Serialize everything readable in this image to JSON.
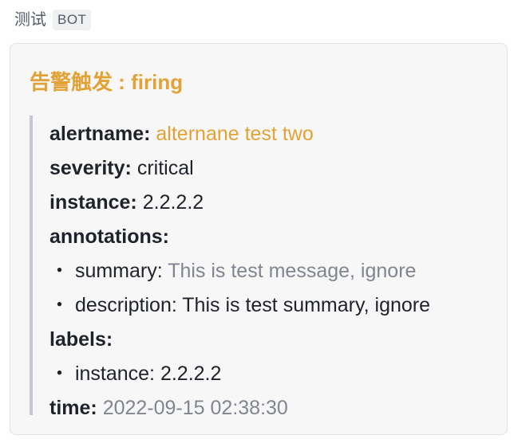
{
  "header": {
    "sender": "测试",
    "badge": "BOT"
  },
  "card": {
    "title": "告警触发 : firing",
    "alertname_key": "alertname:",
    "alertname_val": "alternane test two",
    "severity_key": "severity:",
    "severity_val": "critical",
    "instance_key": "instance:",
    "instance_val": "2.2.2.2",
    "annotations_key": "annotations:",
    "summary_prefix": "・ summary:",
    "summary_val": "This is test message, ignore",
    "description_line": "・ description: This is test summary, ignore",
    "labels_key": "labels:",
    "labels_instance_line": "・ instance: 2.2.2.2",
    "time_key": "time:",
    "time_val": "2022-09-15 02:38:30"
  },
  "colors": {
    "accent": "#e2a235",
    "muted": "#80858f",
    "quote_bar": "#c6c9d4",
    "card_bg": "#f7f7f8"
  }
}
